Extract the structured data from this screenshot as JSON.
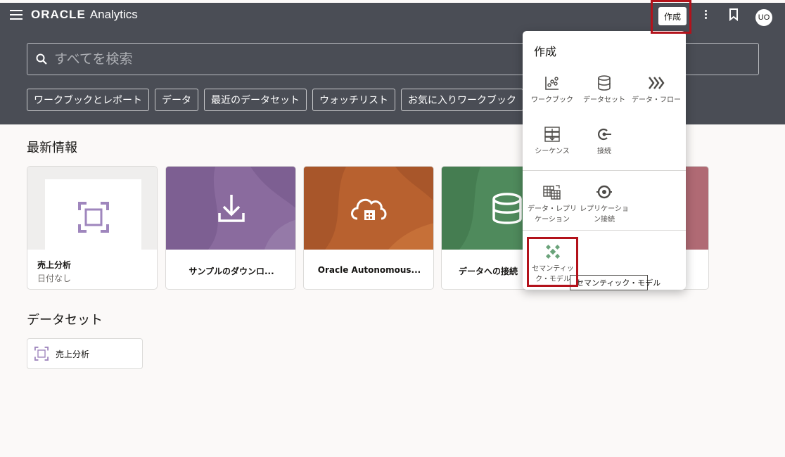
{
  "header": {
    "brand_oracle": "ORACLE",
    "brand_analytics": "Analytics",
    "create_label": "作成",
    "avatar_initials": "UO"
  },
  "search": {
    "placeholder": "すべてを検索"
  },
  "chips": [
    "ワークブックとレポート",
    "データ",
    "最近のデータセット",
    "ウォッチリスト",
    "お気に入りワークブック"
  ],
  "recent": {
    "title": "最新情報",
    "cards": [
      {
        "title": "売上分析",
        "subtitle": "日付なし"
      },
      {
        "title": "サンプルのダウンロ..."
      },
      {
        "title": "Oracle Autonomous..."
      },
      {
        "title": "データへの接続"
      }
    ]
  },
  "datasets": {
    "title": "データセット",
    "items": [
      {
        "label": "売上分析"
      }
    ]
  },
  "create_menu": {
    "title": "作成",
    "items": [
      {
        "label": "ワークブック",
        "icon": "workbook-icon"
      },
      {
        "label": "データセット",
        "icon": "dataset-icon"
      },
      {
        "label": "データ・フロー",
        "icon": "data-flow-icon"
      },
      {
        "label": "シーケンス",
        "icon": "sequence-icon"
      },
      {
        "label": "接続",
        "icon": "connection-icon"
      },
      {
        "label": "データ・レプリケーション",
        "icon": "data-replication-icon"
      },
      {
        "label": "レプリケーション接続",
        "icon": "replication-connection-icon"
      },
      {
        "label": "セマンティック・モデル",
        "icon": "semantic-model-icon"
      }
    ],
    "tooltip": "セマンティック・モデル"
  },
  "colors": {
    "header_bg": "#4a4d55",
    "card_purple": "#8a6b9e",
    "card_orange": "#b8612f",
    "card_green": "#4f8a5c",
    "card_rose": "#b06a74",
    "highlight_red": "#b3121b",
    "semantic_green": "#6aa37a",
    "analysis_icon_purple": "#9f86bd"
  }
}
